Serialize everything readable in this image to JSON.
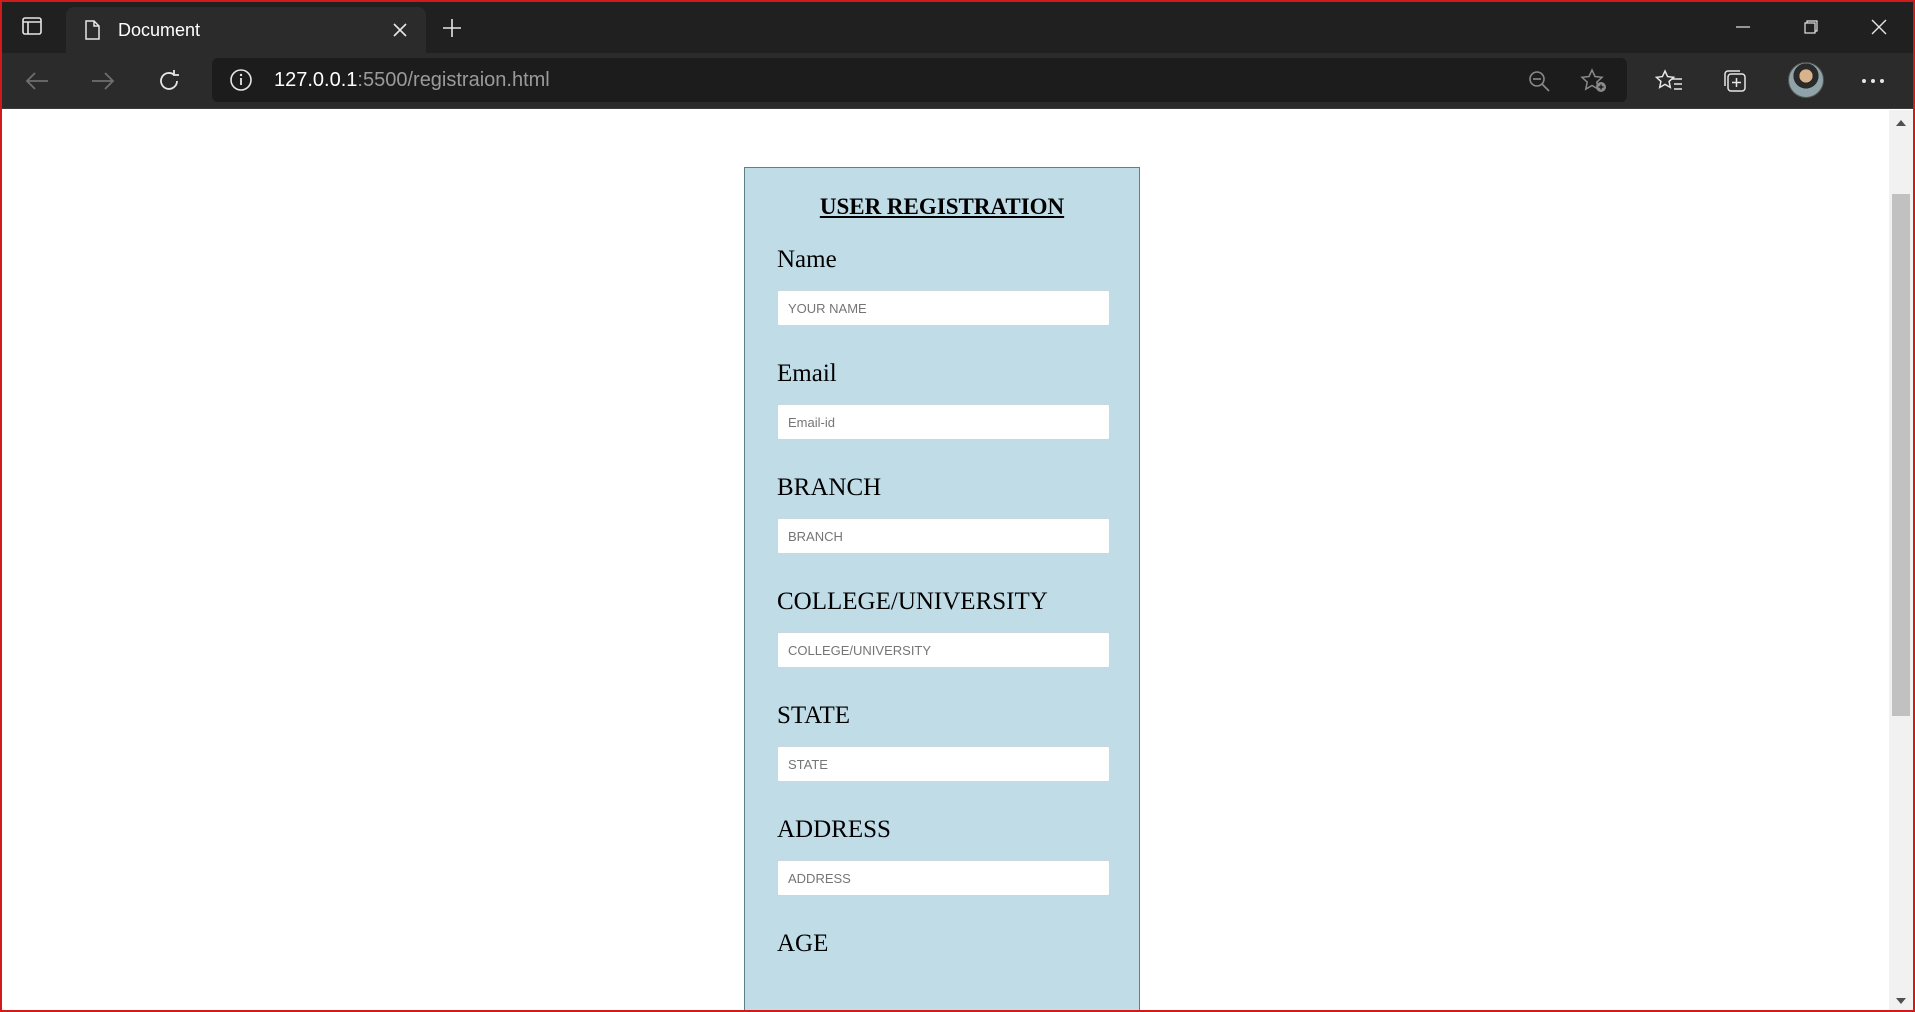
{
  "browser": {
    "tab_title": "Document",
    "url_host": "127.0.0.1",
    "url_rest": ":5500/registraion.html"
  },
  "form": {
    "title": "USER REGISTRATION",
    "fields": [
      {
        "label": "Name",
        "placeholder": "YOUR NAME"
      },
      {
        "label": "Email",
        "placeholder": "Email-id"
      },
      {
        "label": "BRANCH",
        "placeholder": "BRANCH"
      },
      {
        "label": "COLLEGE/UNIVERSITY",
        "placeholder": "COLLEGE/UNIVERSITY"
      },
      {
        "label": "STATE",
        "placeholder": "STATE"
      },
      {
        "label": "ADDRESS",
        "placeholder": "ADDRESS"
      },
      {
        "label": "AGE"
      }
    ]
  },
  "colors": {
    "form_background": "#c0dce7",
    "frame_border": "#d11a1a",
    "chrome_dark": "#202020"
  },
  "icons": [
    "tab-actions-icon",
    "page-icon",
    "close-icon",
    "plus-icon",
    "minimize-icon",
    "restore-icon",
    "back-icon",
    "forward-icon",
    "refresh-icon",
    "info-icon",
    "zoom-out-icon",
    "add-favorite-icon",
    "favorites-icon",
    "collections-icon",
    "more-icon"
  ]
}
